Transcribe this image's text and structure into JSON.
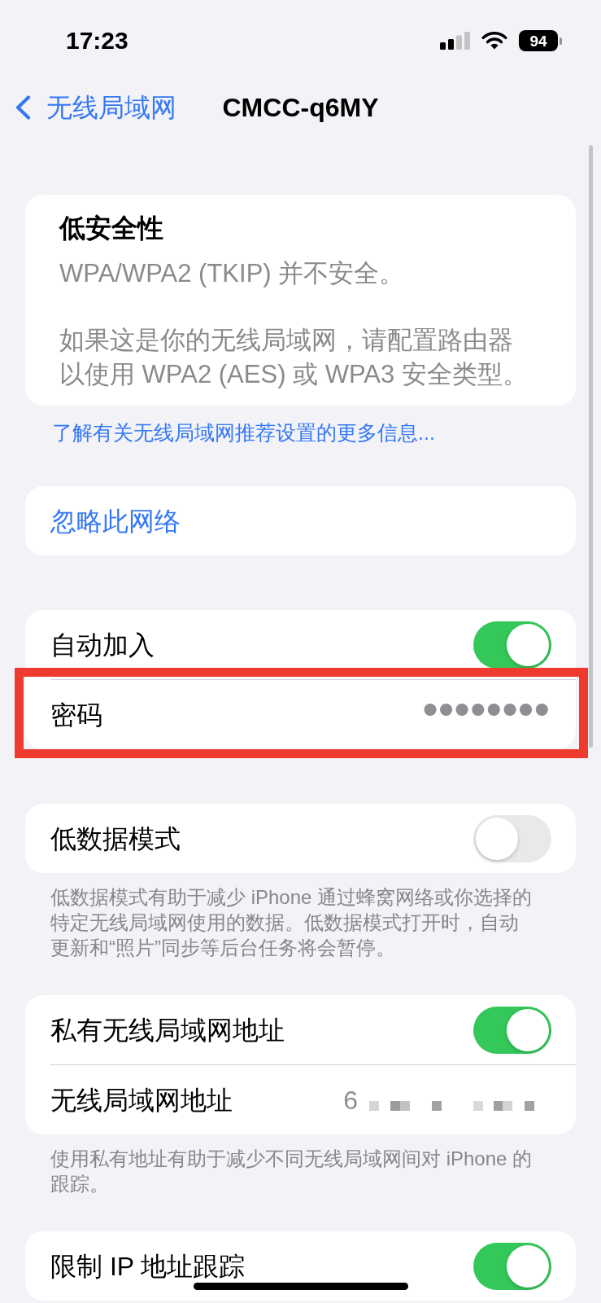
{
  "status_bar": {
    "time": "17:23",
    "battery": "94"
  },
  "nav": {
    "back": "无线局域网",
    "title": "CMCC-q6MY"
  },
  "sections": [
    {
      "kind": "notice",
      "title": "低安全性",
      "paragraphs": [
        "WPA/WPA2 (TKIP) 并不安全。",
        "如果这是你的无线局域网，请配置路由器以使用 WPA2 (AES) 或 WPA3 安全类型。"
      ],
      "link": "了解有关无线局域网推荐设置的更多信息..."
    },
    {
      "kind": "group",
      "rows": [
        {
          "kind": "action",
          "label": "忽略此网络"
        }
      ]
    },
    {
      "kind": "group",
      "rows": [
        {
          "kind": "toggle",
          "label": "自动加入",
          "on": true
        },
        {
          "kind": "value",
          "label": "密码",
          "value": "••••••••",
          "highlighted": true
        }
      ]
    },
    {
      "kind": "group",
      "rows": [
        {
          "kind": "toggle",
          "label": "低数据模式",
          "on": false
        }
      ],
      "footer": "低数据模式有助于减少 iPhone 通过蜂窝网络或你选择的特定无线局域网使用的数据。低数据模式打开时，自动更新和“照片”同步等后台任务将会暂停。"
    },
    {
      "kind": "group",
      "rows": [
        {
          "kind": "toggle",
          "label": "私有无线局域网地址",
          "on": true
        },
        {
          "kind": "value",
          "label": "无线局域网地址",
          "value": "6",
          "redacted": true
        }
      ],
      "footer": "使用私有地址有助于减少不同无线局域网间对 iPhone 的跟踪。"
    },
    {
      "kind": "group",
      "rows": [
        {
          "kind": "toggle",
          "label": "限制 IP 地址跟踪",
          "on": true
        }
      ]
    }
  ]
}
